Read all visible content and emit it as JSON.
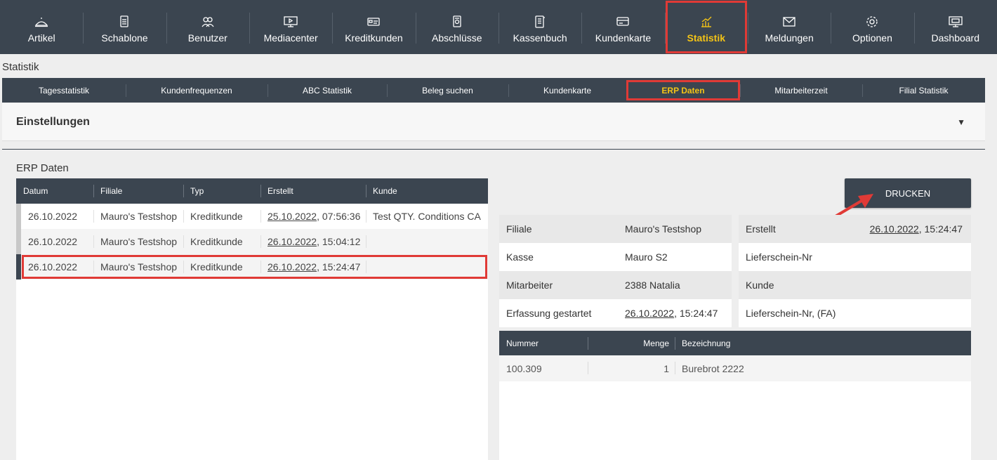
{
  "nav": [
    {
      "label": "Artikel",
      "icon": "articles-icon"
    },
    {
      "label": "Schablone",
      "icon": "template-icon"
    },
    {
      "label": "Benutzer",
      "icon": "users-icon"
    },
    {
      "label": "Mediacenter",
      "icon": "media-monitor-icon"
    },
    {
      "label": "Kreditkunden",
      "icon": "credit-card-icon"
    },
    {
      "label": "Abschlüsse",
      "icon": "closing-doc-icon"
    },
    {
      "label": "Kassenbuch",
      "icon": "cashbook-icon"
    },
    {
      "label": "Kundenkarte",
      "icon": "customer-card-icon"
    },
    {
      "label": "Statistik",
      "icon": "statistics-icon"
    },
    {
      "label": "Meldungen",
      "icon": "envelope-icon"
    },
    {
      "label": "Optionen",
      "icon": "gear-icon"
    },
    {
      "label": "Dashboard",
      "icon": "dashboard-monitor-icon"
    }
  ],
  "page_title": "Statistik",
  "subtabs": [
    "Tagesstatistik",
    "Kundenfrequenzen",
    "ABC Statistik",
    "Beleg suchen",
    "Kundenkarte",
    "ERP Daten",
    "Mitarbeiterzeit",
    "Filial Statistik"
  ],
  "settings_label": "Einstellungen",
  "settings_caret": "▼",
  "section_title": "ERP Daten",
  "list": {
    "headers": [
      "Datum",
      "Filiale",
      "Typ",
      "Erstellt",
      "Kunde"
    ],
    "rows": [
      {
        "datum": "26.10.2022",
        "filiale": "Mauro's Testshop",
        "typ": "Kreditkunde",
        "erstellt_date": "25.10.2022",
        "erstellt_time": ", 07:56:36",
        "kunde": "Test QTY. Conditions CA"
      },
      {
        "datum": "26.10.2022",
        "filiale": "Mauro's Testshop",
        "typ": "Kreditkunde",
        "erstellt_date": "26.10.2022",
        "erstellt_time": ", 15:04:12",
        "kunde": ""
      },
      {
        "datum": "26.10.2022",
        "filiale": "Mauro's Testshop",
        "typ": "Kreditkunde",
        "erstellt_date": "26.10.2022",
        "erstellt_time": ", 15:24:47",
        "kunde": ""
      }
    ]
  },
  "print_label": "DRUCKEN",
  "details_left": [
    {
      "key": "Filiale",
      "value": "Mauro's Testshop",
      "date": "",
      "time": ""
    },
    {
      "key": "Kasse",
      "value": "Mauro S2",
      "date": "",
      "time": ""
    },
    {
      "key": "Mitarbeiter",
      "value": "2388 Natalia",
      "date": "",
      "time": ""
    },
    {
      "key": "Erfassung gestartet",
      "value": "",
      "date": "26.10.2022",
      "time": ", 15:24:47"
    }
  ],
  "details_right": [
    {
      "key": "Erstellt",
      "date": "26.10.2022",
      "time": ", 15:24:47"
    },
    {
      "key": "Lieferschein-Nr",
      "date": "",
      "time": ""
    },
    {
      "key": "Kunde",
      "date": "",
      "time": ""
    },
    {
      "key": "Lieferschein-Nr, (FA)",
      "date": "",
      "time": ""
    }
  ],
  "items": {
    "headers": [
      "Nummer",
      "Menge",
      "Bezeichnung"
    ],
    "rows": [
      {
        "nummer": "100.309",
        "menge": "1",
        "bezeichnung": "Burebrot 2222"
      }
    ]
  },
  "colors": {
    "nav_bg": "#3b4550",
    "active": "#f3c316",
    "highlight": "#e03a36"
  }
}
